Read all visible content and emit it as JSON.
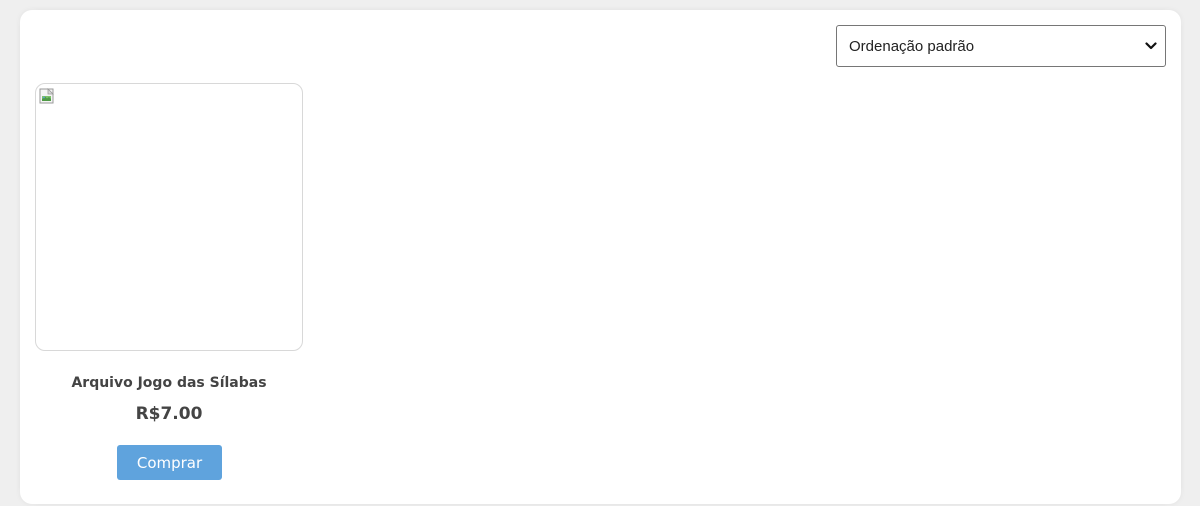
{
  "toolbar": {
    "sort_label": "Ordenação padrão"
  },
  "product": {
    "name": "Arquivo Jogo das Sílabas",
    "price": "R$7.00",
    "buy_label": "Comprar"
  },
  "icons": {
    "sort_chevron": "chevron-down-icon",
    "product_image": "broken-image-icon"
  },
  "colors": {
    "page_background": "#efefef",
    "panel_background": "#ffffff",
    "buy_button": "#5fa3dd",
    "text": "#444444"
  }
}
